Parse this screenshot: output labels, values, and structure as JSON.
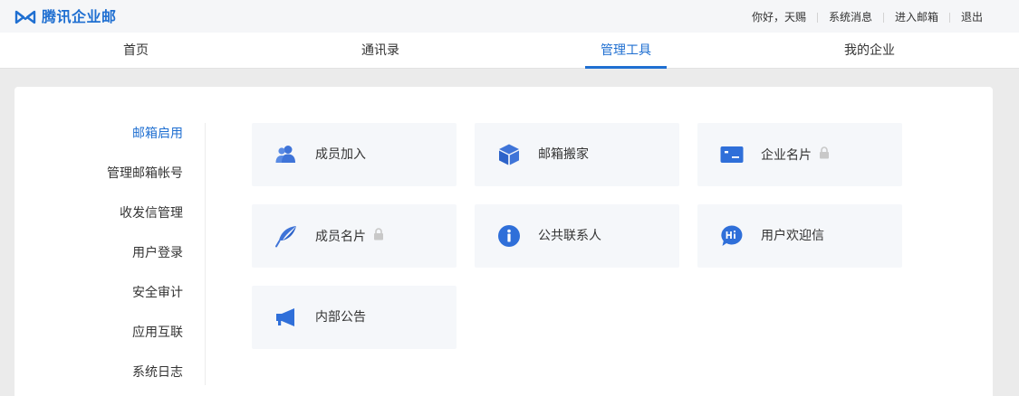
{
  "brand": {
    "name": "腾讯企业邮",
    "color": "#1f6fd1"
  },
  "header": {
    "greeting": "你好，天赐",
    "links": [
      "系统消息",
      "进入邮箱",
      "退出"
    ]
  },
  "nav": {
    "tabs": [
      {
        "label": "首页"
      },
      {
        "label": "通讯录"
      },
      {
        "label": "管理工具",
        "active": true
      },
      {
        "label": "我的企业"
      }
    ]
  },
  "sidebar": {
    "items": [
      {
        "label": "邮箱启用",
        "active": true
      },
      {
        "label": "管理邮箱帐号"
      },
      {
        "label": "收发信管理"
      },
      {
        "label": "用户登录"
      },
      {
        "label": "安全审计"
      },
      {
        "label": "应用互联"
      },
      {
        "label": "系统日志"
      }
    ]
  },
  "tools": [
    {
      "label": "成员加入",
      "icon": "members-icon",
      "locked": false
    },
    {
      "label": "邮箱搬家",
      "icon": "box-icon",
      "locked": false
    },
    {
      "label": "企业名片",
      "icon": "card-icon",
      "locked": true
    },
    {
      "label": "成员名片",
      "icon": "feather-icon",
      "locked": true
    },
    {
      "label": "公共联系人",
      "icon": "info-icon",
      "locked": false
    },
    {
      "label": "用户欢迎信",
      "icon": "hi-bubble-icon",
      "locked": false
    },
    {
      "label": "内部公告",
      "icon": "megaphone-icon",
      "locked": false
    }
  ]
}
